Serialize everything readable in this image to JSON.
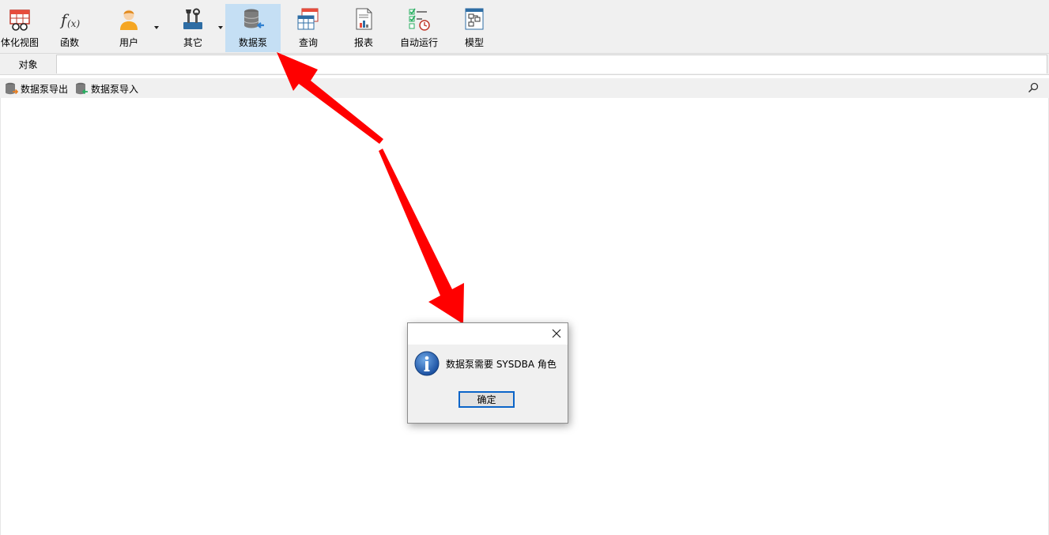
{
  "toolbar": {
    "items": [
      {
        "label": "体化视图",
        "icon": "materialized-view-icon"
      },
      {
        "label": "函数",
        "icon": "function-icon"
      },
      {
        "label": "用户",
        "icon": "user-icon"
      },
      {
        "label": "其它",
        "icon": "tools-icon"
      },
      {
        "label": "数据泵",
        "icon": "data-pump-icon",
        "active": true
      },
      {
        "label": "查询",
        "icon": "query-icon"
      },
      {
        "label": "报表",
        "icon": "report-icon"
      },
      {
        "label": "自动运行",
        "icon": "automation-icon"
      },
      {
        "label": "模型",
        "icon": "model-icon"
      }
    ],
    "active_color": "#c5dff4"
  },
  "tabs": {
    "object_label": "对象"
  },
  "subtoolbar": {
    "export_label": "数据泵导出",
    "import_label": "数据泵导入"
  },
  "dialog": {
    "message": "数据泵需要 SYSDBA 角色",
    "ok_label": "确定"
  },
  "annotation": {
    "arrow_color": "#ff0000"
  }
}
